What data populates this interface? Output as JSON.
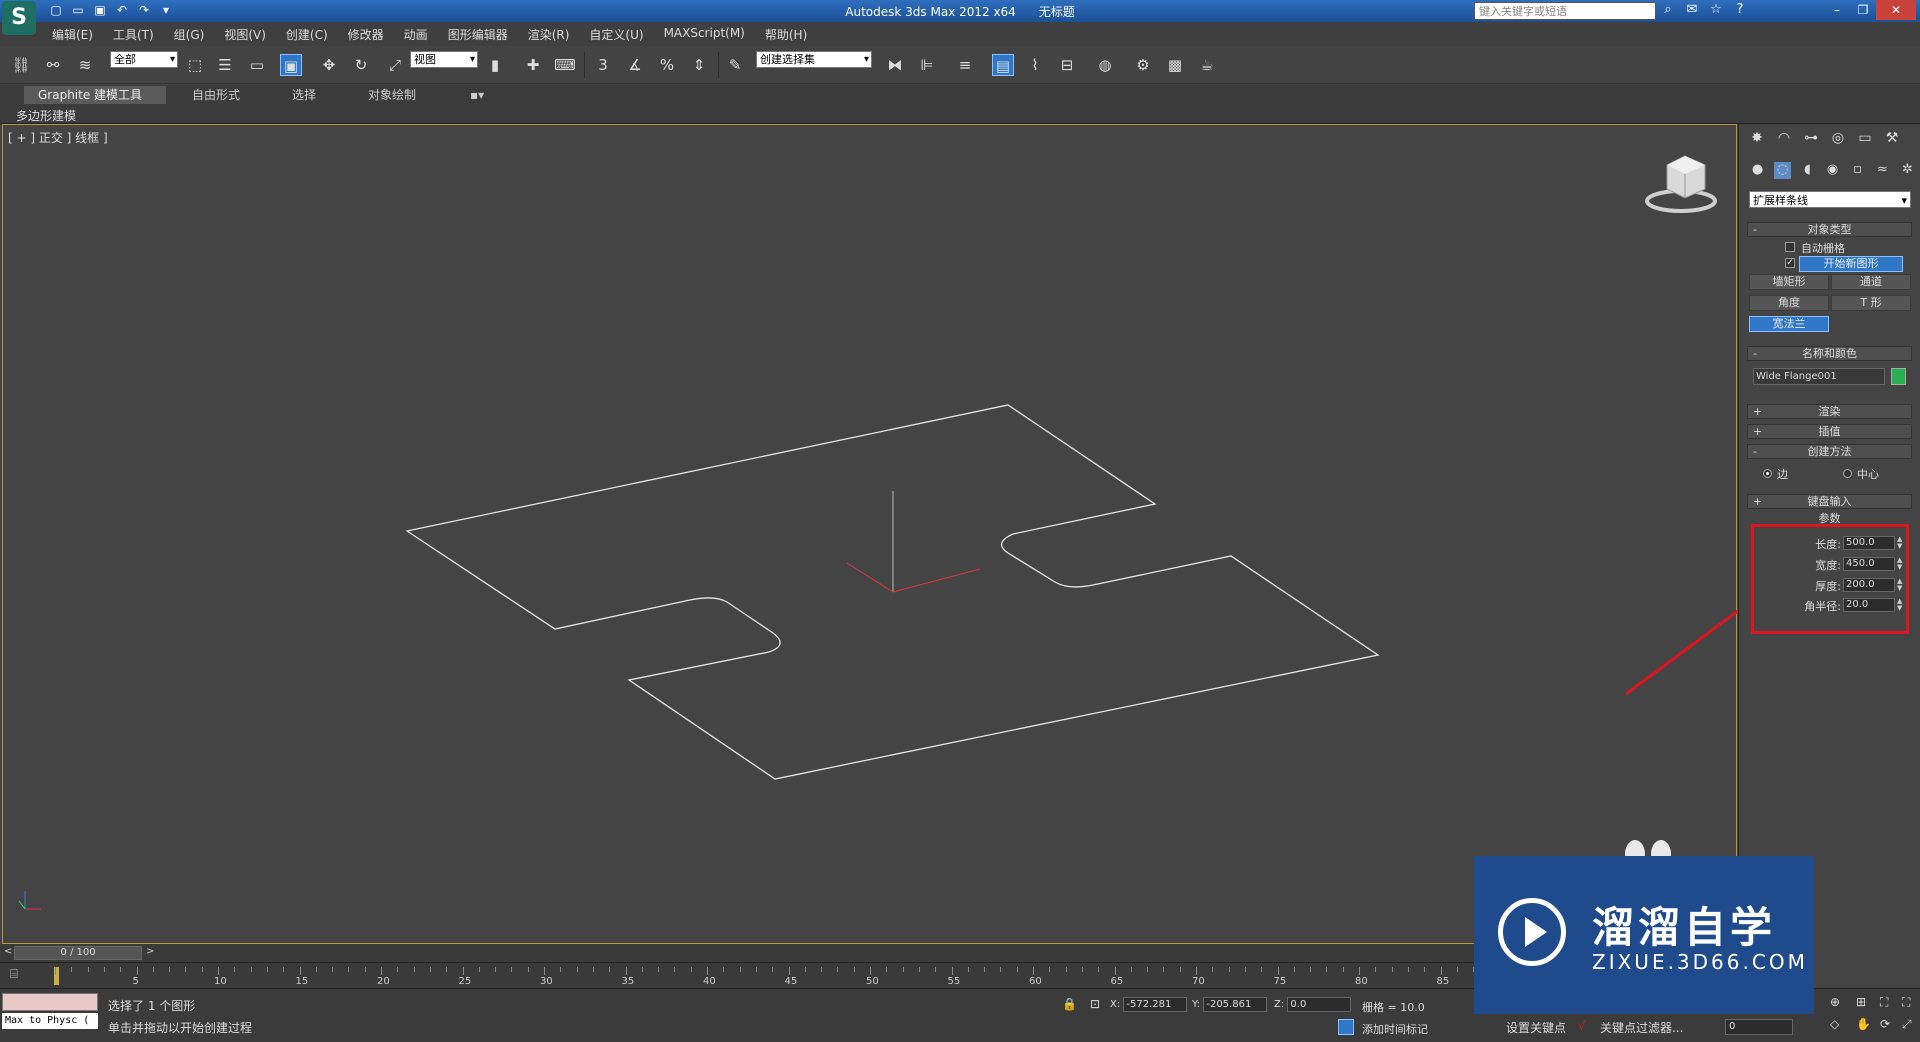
{
  "app": {
    "title": "Autodesk 3ds Max  2012 x64",
    "doc_title": "无标题",
    "search_placeholder": "键入关键字或短语"
  },
  "menu": [
    "编辑(E)",
    "工具(T)",
    "组(G)",
    "视图(V)",
    "创建(C)",
    "修改器",
    "动画",
    "图形编辑器",
    "渲染(R)",
    "自定义(U)",
    "MAXScript(M)",
    "帮助(H)"
  ],
  "toolbar": {
    "selection_filter": "全部",
    "ref_coord": "视图",
    "named_sel": "创建选择集",
    "snap_label": "3"
  },
  "ribbon": {
    "tabs": [
      "Graphite 建模工具",
      "自由形式",
      "选择",
      "对象绘制"
    ],
    "subtitle": "多边形建模"
  },
  "viewport": {
    "label": "[ + ] 正交 ] 线框 ]"
  },
  "cmdpanel": {
    "category": "扩展样条线",
    "object_type": {
      "title": "对象类型",
      "auto_grid": "自动栅格",
      "start_new_shape": "开始新图形",
      "buttons": [
        "墙矩形",
        "通道",
        "角度",
        "T 形",
        "宽法兰"
      ]
    },
    "name_color": {
      "title": "名称和颜色",
      "name": "Wide Flange001",
      "color": "#27b04f"
    },
    "rollouts": {
      "render": "渲染",
      "interpolation": "插值",
      "creation_method": "创建方法",
      "keyboard": "键盘输入",
      "params": "参数"
    },
    "creation": {
      "edge": "边",
      "center": "中心"
    },
    "params": [
      {
        "label": "长度:",
        "value": "500.0"
      },
      {
        "label": "宽度:",
        "value": "450.0"
      },
      {
        "label": "厚度:",
        "value": "200.0"
      },
      {
        "label": "角半径:",
        "value": "20.0"
      }
    ]
  },
  "time": {
    "slider": "0 / 100",
    "ticks": [
      "5",
      "10",
      "15",
      "20",
      "25",
      "30",
      "35",
      "40",
      "45",
      "50",
      "55",
      "60",
      "65",
      "70",
      "75",
      "80",
      "85"
    ]
  },
  "status": {
    "maxscript": "Max to Physc (",
    "selected": "选择了 1 个图形",
    "prompt": "单击并拖动以开始创建过程",
    "x_label": "X:",
    "x": "-572.281",
    "y_label": "Y:",
    "y": "-205.861",
    "z_label": "Z:",
    "z": "0.0",
    "grid": "栅格 = 10.0",
    "add_time_tag": "添加时间标记",
    "set_key": "设置关键点",
    "key_filters": "关键点过滤器...",
    "frame": "0"
  },
  "watermark": {
    "brand": "溜溜自学",
    "url": "ZIXUE.3D66.COM"
  },
  "colors": {
    "highlight_red": "#e0141e",
    "accent_blue": "#2f78c8"
  }
}
